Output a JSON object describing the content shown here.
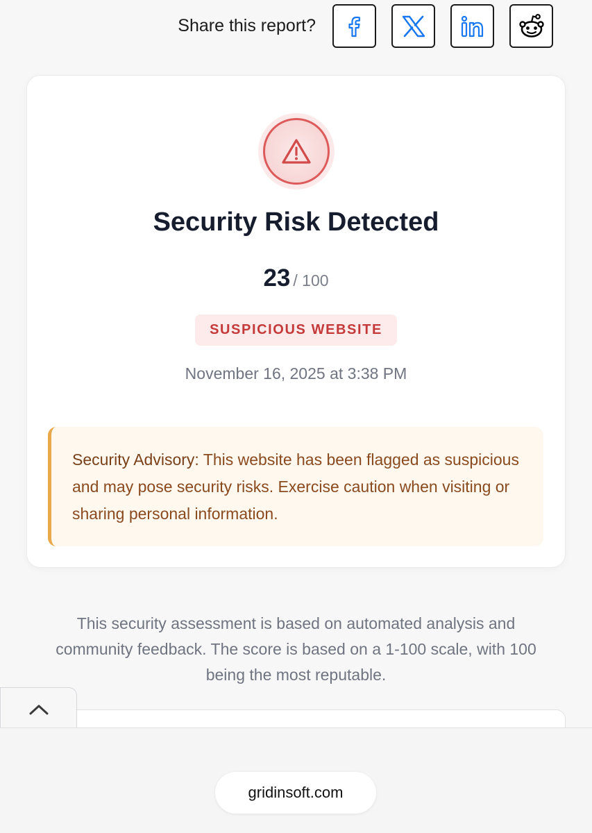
{
  "share": {
    "label": "Share this report?",
    "buttons": [
      {
        "icon": "facebook-icon",
        "color": "#1877f2"
      },
      {
        "icon": "x-icon",
        "color": "#1877f2"
      },
      {
        "icon": "linkedin-icon",
        "color": "#1877f2"
      },
      {
        "icon": "reddit-icon",
        "color": "#000000"
      }
    ]
  },
  "report": {
    "status_icon": "warning-icon",
    "title": "Security Risk Detected",
    "score": "23",
    "score_max": "/ 100",
    "badge": "SUSPICIOUS WEBSITE",
    "timestamp": "November 16, 2025 at 3:38 PM",
    "advisory": {
      "label": "Security Advisory:",
      "text": "This website has been flagged as suspicious and may pose security risks. Exercise caution when visiting or sharing personal information."
    }
  },
  "footnote": "This security assessment is based on automated analysis and community feedback. The score is based on a 1-100 scale, with 100 being the most reputable.",
  "browser": {
    "url": "gridinsoft.com"
  },
  "colors": {
    "danger": "#dd5a5a",
    "badge_text": "#c43a3a",
    "advisory_border": "#e9a84a",
    "share_accent": "#1877f2"
  }
}
